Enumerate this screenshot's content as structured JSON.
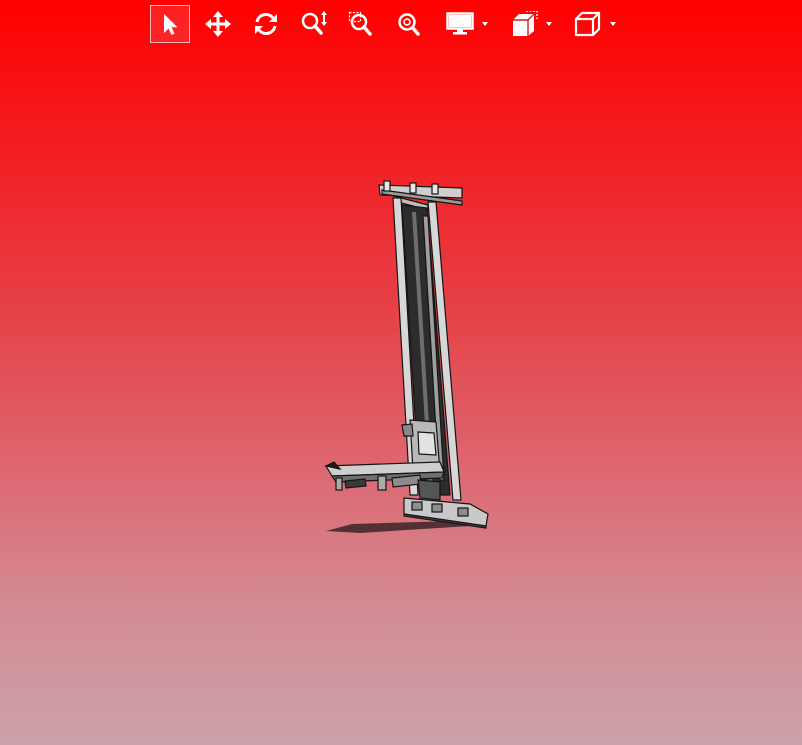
{
  "toolbar": {
    "tools": [
      {
        "icon": "select-pointer-icon",
        "active": true
      },
      {
        "icon": "pan-icon",
        "active": false
      },
      {
        "icon": "rotate-icon",
        "active": false
      },
      {
        "icon": "zoom-icon",
        "active": false
      },
      {
        "icon": "zoom-window-icon",
        "active": false
      },
      {
        "icon": "zoom-fit-icon",
        "active": false
      },
      {
        "icon": "display-mode-icon",
        "active": false,
        "dropdown": true
      },
      {
        "icon": "section-view-icon",
        "active": false,
        "dropdown": true
      },
      {
        "icon": "view-orientation-cube-icon",
        "active": false,
        "dropdown": true
      }
    ]
  },
  "colors": {
    "background_top": "#ff0000",
    "background_bottom": "#cca1a9",
    "icon": "#ffffff",
    "model_frame": "#d9d9d9",
    "model_outline": "#1a1a1a"
  }
}
